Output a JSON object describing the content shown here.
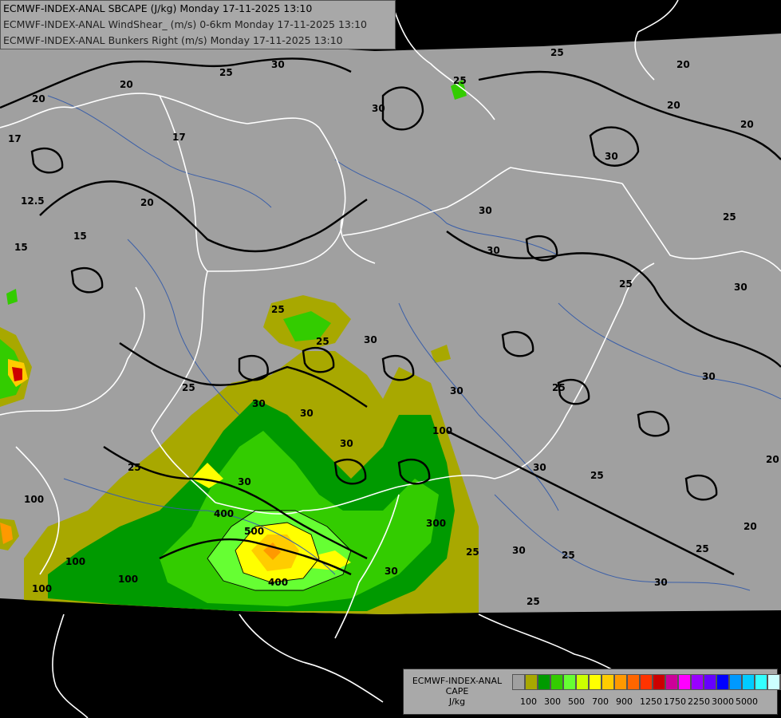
{
  "title_lines": [
    "ECMWF-INDEX-ANAL SBCAPE (J/kg) Monday 17-11-2025 13:10",
    "ECMWF-INDEX-ANAL WindShear_ (m/s) 0-6km Monday 17-11-2025 13:10",
    "ECMWF-INDEX-ANAL Bunkers Right (m/s) Monday 17-11-2025 13:10"
  ],
  "legend": {
    "line1": "ECMWF-INDEX-ANAL",
    "line2": "CAPE",
    "line3": "J/kg",
    "swatch_colors": [
      "#a0a0a0",
      "#a8a800",
      "#009a00",
      "#33cc00",
      "#66ff33",
      "#ccff00",
      "#ffff00",
      "#ffcc00",
      "#ff9900",
      "#ff6600",
      "#ff3300",
      "#cc0000",
      "#cc0099",
      "#ff00ff",
      "#9900ff",
      "#6600ff",
      "#0000ff",
      "#0099ff",
      "#00ccff",
      "#33ffff",
      "#ccffff",
      "#ffffff"
    ],
    "tick_labels": [
      "100",
      "300",
      "500",
      "700",
      "900",
      "1250",
      "1750",
      "2250",
      "3000",
      "5000"
    ]
  },
  "map_labels": [
    "20",
    "25",
    "30",
    "30",
    "25",
    "30",
    "25",
    "20",
    "20",
    "20",
    "20",
    "17",
    "17",
    "12.5",
    "15",
    "15",
    "20",
    "30",
    "30",
    "30",
    "30",
    "25",
    "30",
    "25",
    "25",
    "25",
    "30",
    "30",
    "25",
    "25",
    "25",
    "30",
    "30",
    "20",
    "25",
    "30",
    "30",
    "25",
    "100",
    "100",
    "100",
    "100",
    "100",
    "400",
    "500",
    "300",
    "400",
    "30",
    "30",
    "25",
    "30",
    "25",
    "20",
    "25"
  ],
  "colors": {
    "sea": "#000000",
    "land": "#a0a0a0",
    "border": "#ffffff",
    "river": "#3b5fa8",
    "contour": "#000000"
  }
}
